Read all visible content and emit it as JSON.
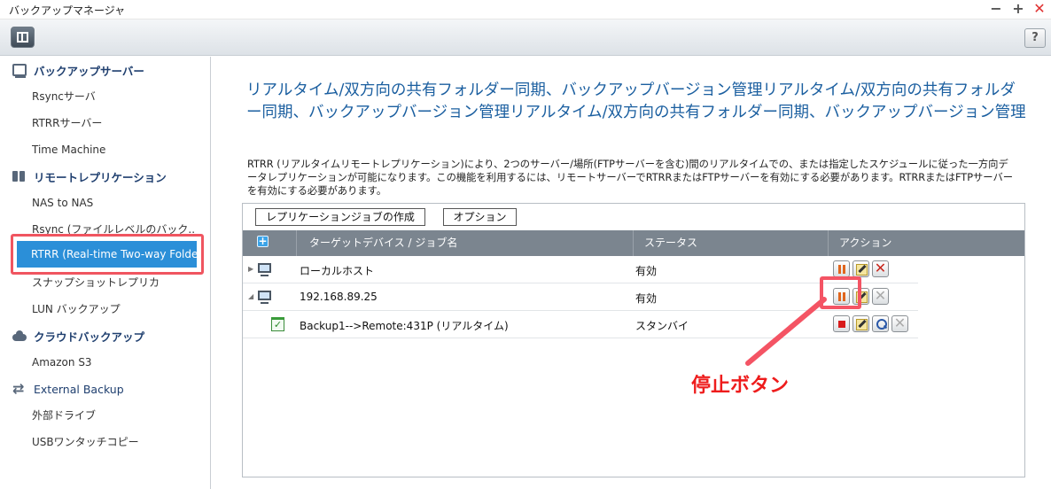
{
  "window": {
    "title": "バックアップマネージャ",
    "help": "?"
  },
  "sidebar": {
    "groups": [
      {
        "label": "バックアップサーバー",
        "icon": "server-icon",
        "items": [
          "Rsyncサーバ",
          "RTRRサーバー",
          "Time Machine"
        ]
      },
      {
        "label": "リモートレプリケーション",
        "icon": "replication-icon",
        "items": [
          "NAS to NAS",
          "Rsync (ファイルレベルのバック..",
          "RTRR (Real-time Two-way Folder ...",
          "スナップショットレプリカ",
          "LUN バックアップ"
        ]
      },
      {
        "label": "クラウドバックアップ",
        "icon": "cloud-icon",
        "items": [
          "Amazon S3"
        ]
      },
      {
        "label": "External Backup",
        "icon": "sync-icon",
        "items": [
          "外部ドライブ",
          "USBワンタッチコピー"
        ]
      }
    ],
    "selected": "RTRR (Real-time Two-way Folder ..."
  },
  "main": {
    "title": "リアルタイム/双方向の共有フォルダー同期、バックアップバージョン管理リアルタイム/双方向の共有フォルダー同期、バックアップバージョン管理リアルタイム/双方向の共有フォルダー同期、バックアップバージョン管理",
    "description": "RTRR (リアルタイムリモートレプリケーション)により、2つのサーバー/場所(FTPサーバーを含む)間のリアルタイムでの、または指定したスケジュールに従った一方向データレプリケーションが可能になります。この機能を利用するには、リモートサーバーでRTRRまたはFTPサーバーを有効にする必要があります。RTRRまたはFTPサーバーを有効にする必要があります。",
    "buttons": {
      "create": "レプリケーションジョブの作成",
      "options": "オプション"
    },
    "table": {
      "headers": {
        "target": "ターゲットデバイス / ジョブ名",
        "status": "ステータス",
        "action": "アクション"
      },
      "rows": [
        {
          "name": "ローカルホスト",
          "status": "有効"
        },
        {
          "name": "192.168.89.25",
          "status": "有効"
        },
        {
          "name": "Backup1-->Remote:431P (リアルタイム)",
          "status": "スタンバイ"
        }
      ]
    }
  },
  "annotation": {
    "text": "停止ボタン",
    "color": "#ee1c1c"
  },
  "colors": {
    "accent": "#2b8fd8",
    "title": "#1b5fa0",
    "highlight": "#f45464"
  }
}
